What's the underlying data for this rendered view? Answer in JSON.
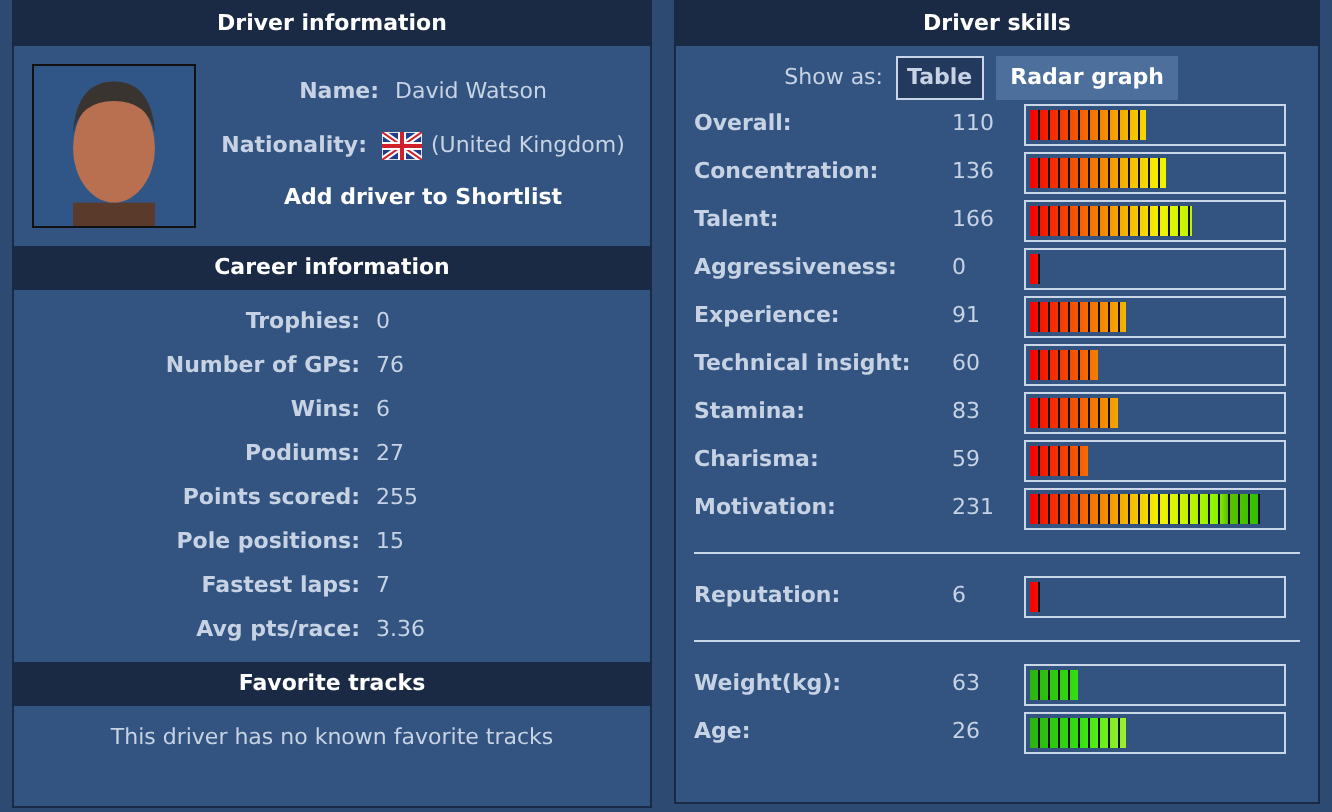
{
  "driver_info": {
    "title": "Driver information",
    "fields": [
      {
        "label": "Name:",
        "value": "David Watson"
      },
      {
        "label": "Nationality:",
        "value": "(United Kingdom)",
        "kind": "flag"
      }
    ],
    "shortlist_link": "Add driver to Shortlist"
  },
  "career_info": {
    "title": "Career information",
    "rows": [
      {
        "label": "Trophies:",
        "value": "0"
      },
      {
        "label": "Number of GPs:",
        "value": "76"
      },
      {
        "label": "Wins:",
        "value": "6"
      },
      {
        "label": "Podiums:",
        "value": "27"
      },
      {
        "label": "Points scored:",
        "value": "255"
      },
      {
        "label": "Pole positions:",
        "value": "15"
      },
      {
        "label": "Fastest laps:",
        "value": "7"
      },
      {
        "label": "Avg pts/race:",
        "value": "3.36"
      }
    ]
  },
  "favorite_tracks": {
    "title": "Favorite tracks",
    "message": "This driver has no known favorite tracks"
  },
  "skills": {
    "title": "Driver skills",
    "show_as_label": "Show as:",
    "tabs": [
      {
        "label": "Table",
        "selected": true
      },
      {
        "label": "Radar graph",
        "selected": false
      }
    ],
    "groups": [
      [
        {
          "label": "Overall:",
          "value": "110",
          "level": 0.46,
          "kind": "skill"
        },
        {
          "label": "Concentration:",
          "value": "136",
          "level": 0.54,
          "kind": "skill"
        },
        {
          "label": "Talent:",
          "value": "166",
          "level": 0.65,
          "kind": "skill"
        },
        {
          "label": "Aggressiveness:",
          "value": "0",
          "level": 0.04,
          "kind": "skill"
        },
        {
          "label": "Experience:",
          "value": "91",
          "level": 0.38,
          "kind": "skill"
        },
        {
          "label": "Technical insight:",
          "value": "60",
          "level": 0.27,
          "kind": "skill"
        },
        {
          "label": "Stamina:",
          "value": "83",
          "level": 0.35,
          "kind": "skill"
        },
        {
          "label": "Charisma:",
          "value": "59",
          "level": 0.23,
          "kind": "skill"
        },
        {
          "label": "Motivation:",
          "value": "231",
          "level": 0.92,
          "kind": "skill"
        }
      ],
      [
        {
          "label": "Reputation:",
          "value": "6",
          "level": 0.04,
          "kind": "skill"
        }
      ],
      [
        {
          "label": "Weight(kg):",
          "value": "63",
          "level": 0.19,
          "kind": "physical"
        },
        {
          "label": "Age:",
          "value": "26",
          "level": 0.38,
          "kind": "physical"
        }
      ]
    ]
  }
}
